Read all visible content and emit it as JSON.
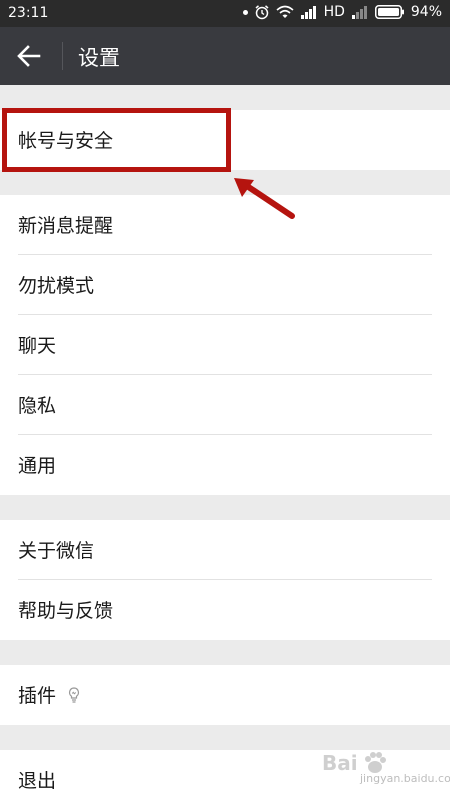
{
  "status_bar": {
    "time": "23:11",
    "network": "HD",
    "battery": "94%"
  },
  "app_bar": {
    "title": "设置"
  },
  "groups": [
    {
      "items": [
        {
          "label": "帐号与安全"
        }
      ]
    },
    {
      "items": [
        {
          "label": "新消息提醒"
        },
        {
          "label": "勿扰模式"
        },
        {
          "label": "聊天"
        },
        {
          "label": "隐私"
        },
        {
          "label": "通用"
        }
      ]
    },
    {
      "items": [
        {
          "label": "关于微信"
        },
        {
          "label": "帮助与反馈"
        }
      ]
    },
    {
      "items": [
        {
          "label": "插件"
        }
      ]
    },
    {
      "items": [
        {
          "label": "退出"
        }
      ]
    }
  ],
  "icons": {
    "back": "arrow-left-icon",
    "plugin": "lightbulb-icon"
  },
  "colors": {
    "app_bar": "#393a3f",
    "status_bar": "#2b2b2b",
    "background": "#ebebeb",
    "annotation": "#b5140f"
  },
  "watermark": {
    "text": "jingyan.baidu.com"
  }
}
